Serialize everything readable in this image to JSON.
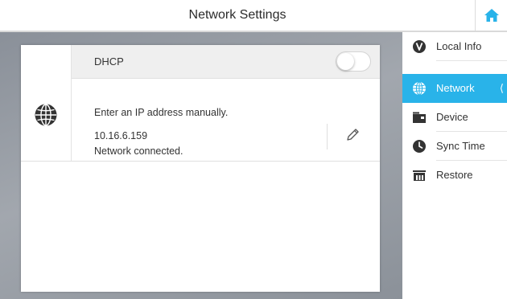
{
  "header": {
    "title": "Network Settings",
    "home_icon": "home-icon"
  },
  "colors": {
    "accent": "#29b3e9",
    "background": "#9aa0a7"
  },
  "network": {
    "dhcp_label": "DHCP",
    "dhcp_enabled": false,
    "manual_ip_label": "Enter an IP address manually.",
    "ip_address": "10.16.6.159",
    "status": "Network connected.",
    "icon": "globe-icon",
    "edit_icon": "pencil-icon"
  },
  "sidebar": {
    "items": [
      {
        "label": "Local Info",
        "icon": "info-icon",
        "active": false
      },
      {
        "label": "Network",
        "icon": "globe-icon",
        "active": true
      },
      {
        "label": "Device",
        "icon": "device-icon",
        "active": false
      },
      {
        "label": "Sync Time",
        "icon": "clock-icon",
        "active": false
      },
      {
        "label": "Restore",
        "icon": "restore-icon",
        "active": false
      }
    ]
  }
}
